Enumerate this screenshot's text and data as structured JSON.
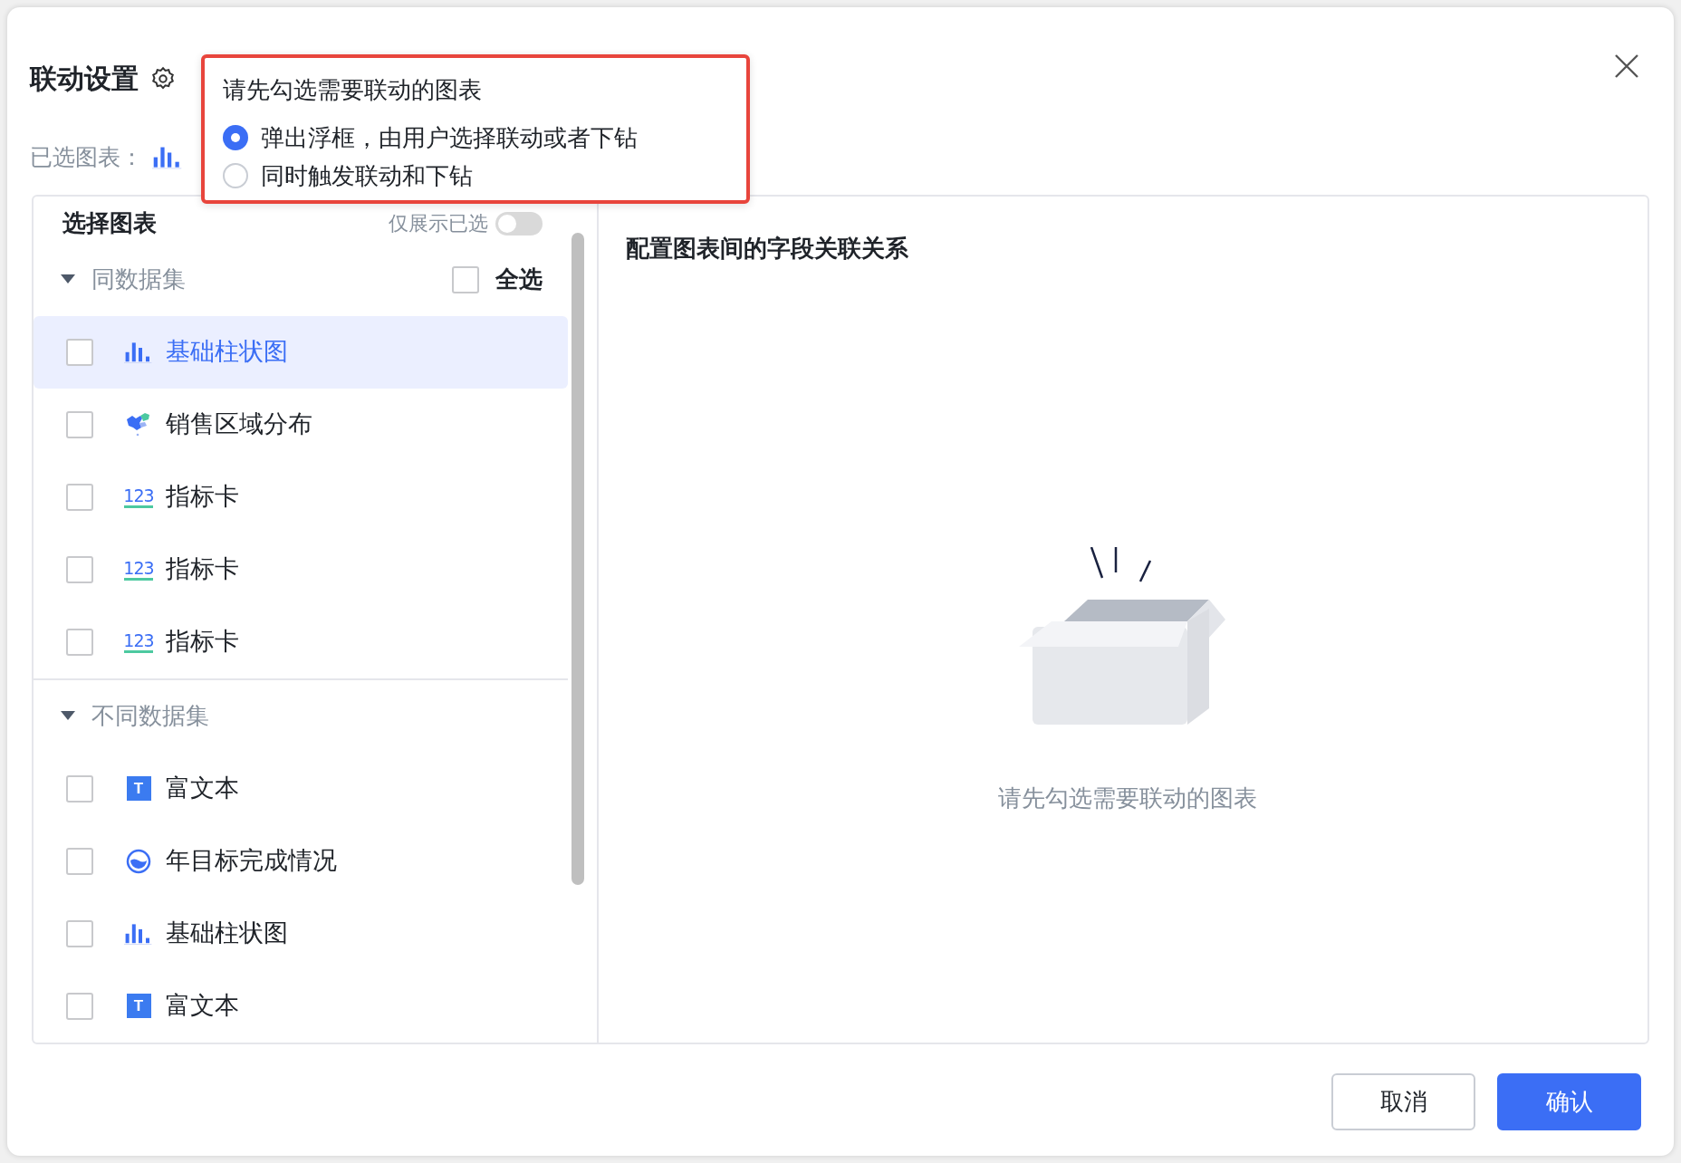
{
  "dialog": {
    "title": "联动设置",
    "selected_label": "已选图表："
  },
  "popover": {
    "title": "请先勾选需要联动的图表",
    "options": [
      {
        "label": "弹出浮框，由用户选择联动或者下钻",
        "selected": true
      },
      {
        "label": "同时触发联动和下钻",
        "selected": false
      }
    ]
  },
  "left_panel": {
    "title": "选择图表",
    "toggle": {
      "label": "仅展示已选",
      "on": false
    },
    "groups": [
      {
        "label": "同数据集",
        "expanded": true,
        "select_all": {
          "label": "全选",
          "checked": false
        },
        "items": [
          {
            "label": "基础柱状图",
            "kind": "bar",
            "checked": false,
            "selected": true
          },
          {
            "label": "销售区域分布",
            "kind": "map",
            "checked": false,
            "selected": false
          },
          {
            "label": "指标卡",
            "kind": "metric",
            "icon_text": "123",
            "checked": false,
            "selected": false
          },
          {
            "label": "指标卡",
            "kind": "metric",
            "icon_text": "123",
            "checked": false,
            "selected": false
          },
          {
            "label": "指标卡",
            "kind": "metric",
            "icon_text": "123",
            "checked": false,
            "selected": false
          }
        ]
      },
      {
        "label": "不同数据集",
        "expanded": true,
        "items": [
          {
            "label": "富文本",
            "kind": "text",
            "icon_text": "T",
            "checked": false,
            "selected": false
          },
          {
            "label": "年目标完成情况",
            "kind": "gauge",
            "checked": false,
            "selected": false
          },
          {
            "label": "基础柱状图",
            "kind": "bar",
            "checked": false,
            "selected": false
          },
          {
            "label": "富文本",
            "kind": "text",
            "icon_text": "T",
            "checked": false,
            "selected": false
          }
        ]
      }
    ]
  },
  "right_panel": {
    "title": "配置图表间的字段关联关系",
    "empty_text": "请先勾选需要联动的图表"
  },
  "buttons": [
    {
      "label": "取消",
      "kind": "secondary"
    },
    {
      "label": "确认",
      "kind": "primary"
    }
  ]
}
